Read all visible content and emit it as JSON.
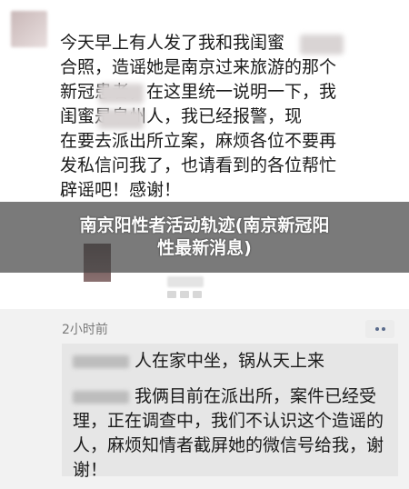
{
  "post": {
    "text": "今天早上有人发了我和我闺蜜的合照，造谣她是南京过来旅游的那个新冠患者，在这里统一说明一下，我闺蜜是泉州人，我已经报警，现在要去派出所立案，麻烦各位不要再发私信问我了，也请看到的各位帮忙辟谣吧！感谢！",
    "lines": [
      "今天早上有人发了我和我闺蜜",
      "合照，造谣她是南京过来旅游的那个",
      "新冠患者，在这里统一说明一下，我",
      "闺蜜是泉州人，我已经报警，现",
      "在要去派出所立案，麻烦各位不要再",
      "发私信问我了，也请看到的各位帮忙",
      "辟谣吧！感谢！"
    ]
  },
  "banner": {
    "line1": "南京阳性者活动轨迹(南京新冠阳",
    "line2": "性最新消息)"
  },
  "timestamp": "2小时前",
  "comments": [
    {
      "text": "人在家中坐，锅从天上来"
    },
    {
      "line1": "我俩目前在派出所，案件已经受",
      "line2": "理，正在调查中，我们不认识这个造谣的",
      "line3": "人，麻烦知情者截屏她的微信号给我，谢",
      "line4": "谢！"
    }
  ]
}
